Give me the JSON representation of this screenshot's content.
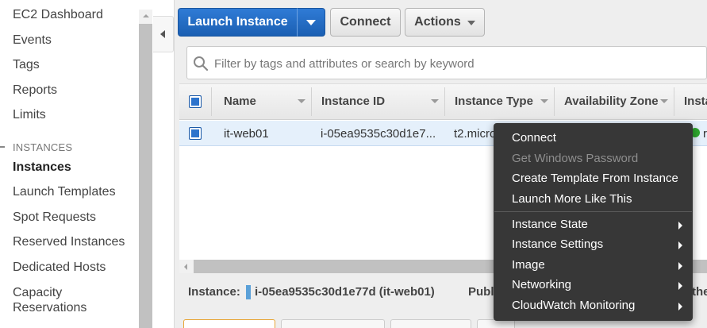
{
  "sidebar": {
    "items": [
      {
        "label": "EC2 Dashboard"
      },
      {
        "label": "Events"
      },
      {
        "label": "Tags"
      },
      {
        "label": "Reports"
      },
      {
        "label": "Limits"
      }
    ],
    "section_title": "INSTANCES",
    "section_items": [
      {
        "label": "Instances",
        "active": true
      },
      {
        "label": "Launch Templates"
      },
      {
        "label": "Spot Requests"
      },
      {
        "label": "Reserved Instances"
      },
      {
        "label": "Dedicated Hosts"
      },
      {
        "label": "Capacity",
        "label2": "Reservations"
      }
    ]
  },
  "toolbar": {
    "launch_label": "Launch Instance",
    "connect_label": "Connect",
    "actions_label": "Actions"
  },
  "search": {
    "placeholder": "Filter by tags and attributes or search by keyword"
  },
  "table": {
    "columns": [
      "Name",
      "Instance ID",
      "Instance Type",
      "Availability Zone",
      "Insta"
    ],
    "rows": [
      {
        "name": "it-web01",
        "instance_id": "i-05ea9535c30d1e7...",
        "instance_type": "t2.micro",
        "state_partial": "r"
      }
    ]
  },
  "detail": {
    "label": "Instance:",
    "value": "i-05ea9535c30d1e77d (it-web01)",
    "public_partial": "Publ",
    "right_partial": "the"
  },
  "context_menu": {
    "items": [
      {
        "label": "Connect",
        "enabled": true
      },
      {
        "label": "Get Windows Password",
        "enabled": false
      },
      {
        "label": "Create Template From Instance",
        "enabled": true
      },
      {
        "label": "Launch More Like This",
        "enabled": true
      }
    ],
    "submenus": [
      {
        "label": "Instance State"
      },
      {
        "label": "Instance Settings"
      },
      {
        "label": "Image"
      },
      {
        "label": "Networking"
      },
      {
        "label": "CloudWatch Monitoring"
      }
    ]
  },
  "colors": {
    "primary_button": "#1b5fb2",
    "menu_background": "#373737",
    "selected_row": "#e5f0fb",
    "status_running": "#2ea82e"
  }
}
